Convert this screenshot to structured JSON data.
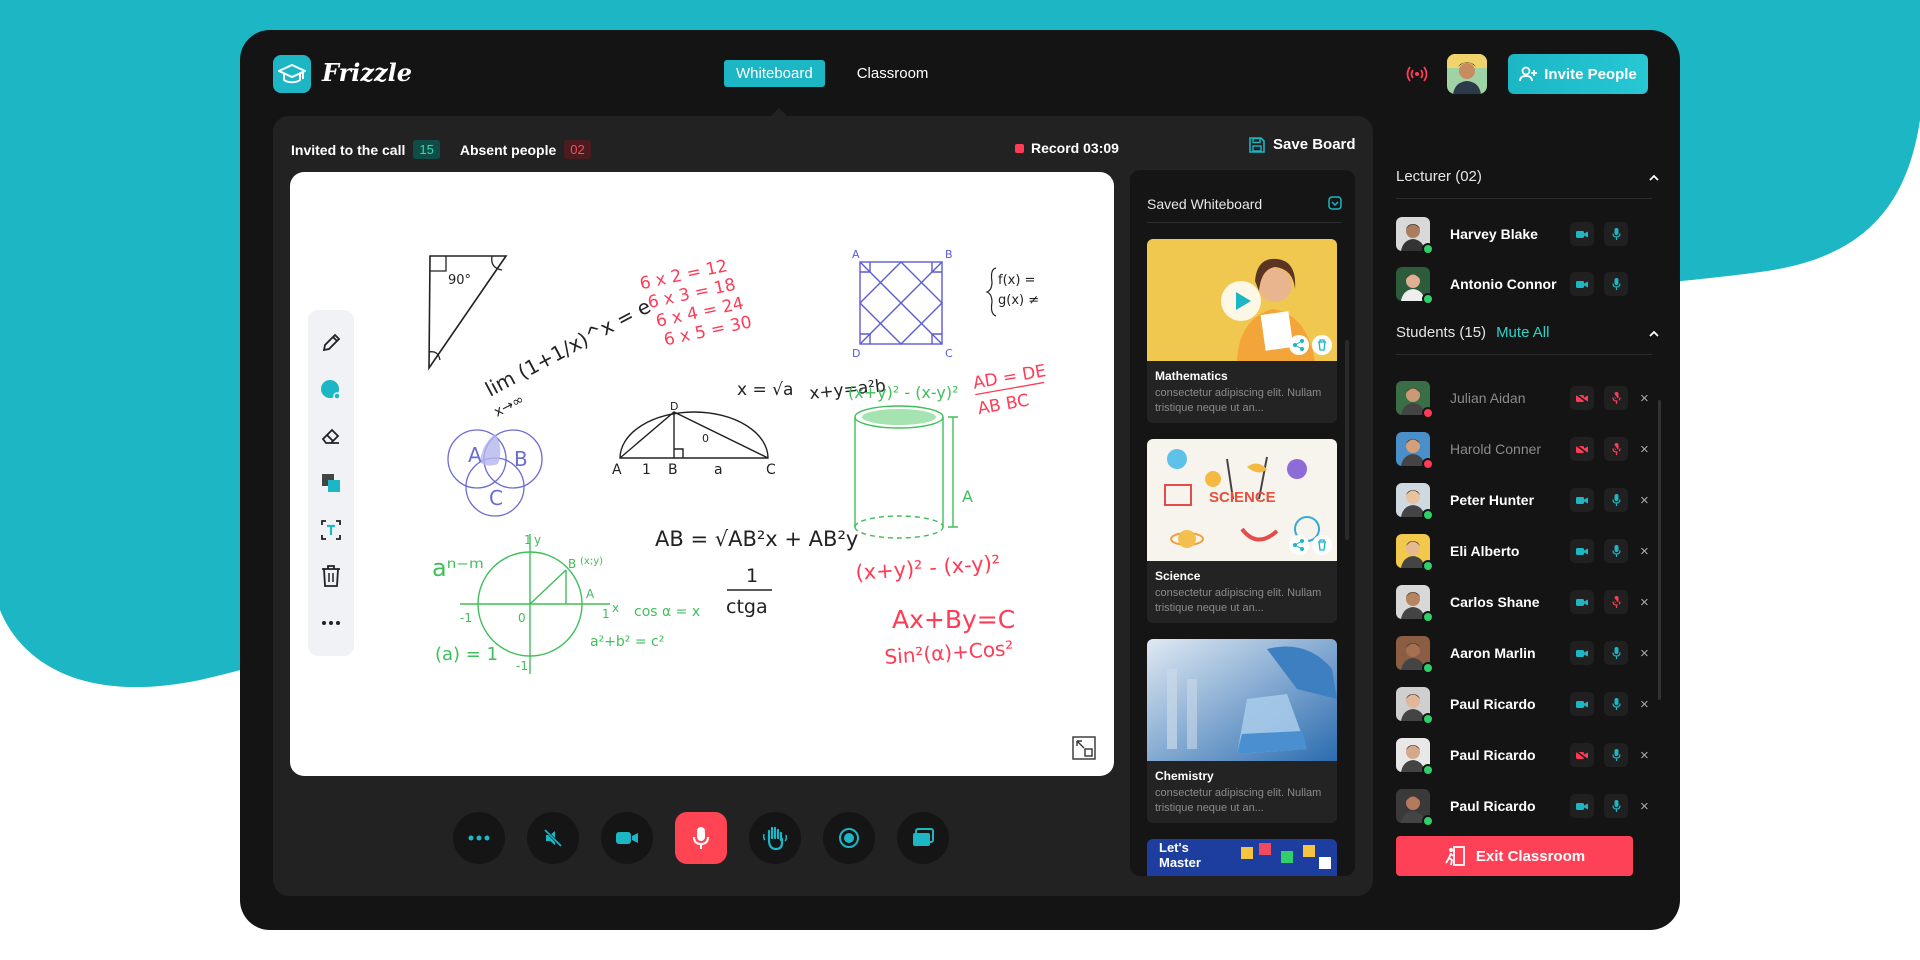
{
  "app": {
    "brand": "Frizzle"
  },
  "tabs": [
    {
      "label": "Whiteboard",
      "active": true
    },
    {
      "label": "Classroom",
      "active": false
    }
  ],
  "header": {
    "invite_label": "Invite People"
  },
  "call": {
    "invited_label": "Invited to the call",
    "invited_count": "15",
    "absent_label": "Absent people",
    "absent_count": "02",
    "record_label": "Record 03:09",
    "save_label": "Save Board"
  },
  "whiteboard": {
    "tools": [
      "pencil-icon",
      "color-picker-icon",
      "eraser-icon",
      "layers-icon",
      "text-tool-icon",
      "trash-icon",
      "more-icon"
    ],
    "handwriting": {
      "angle": "90°",
      "limit": "lim (1+1/x)^x = e",
      "limit_sub": "x→∞",
      "table": [
        "6 x 2 = 12",
        "6 x 3 = 18",
        "6 x 4 = 24",
        "6 x 5 = 30"
      ],
      "func1": "f(x) =",
      "func2": "g(x) ≠",
      "sqrt": "x = √a",
      "xya": "x+y=a²b",
      "ratio_top": "AD = DE",
      "ratio_bot": "AB   BC",
      "venn": [
        "A",
        "B",
        "C"
      ],
      "tri_labels": [
        "A",
        "1",
        "B",
        "a",
        "C",
        "D",
        "0"
      ],
      "cyl_eq": "(x+y)² - (x-y)²",
      "cyl_a": "A",
      "ab_eq": "AB = √AB²x + AB²y",
      "frac_num": "1",
      "frac_den": "ctga",
      "apow": "aⁿ⁻ᵐ",
      "a0": "(a) = 1",
      "circle_labels": [
        "1",
        "y",
        "B",
        "(x;y)",
        "A",
        "1",
        "x",
        "-1",
        "0",
        "-1"
      ],
      "cos": "cos α = x",
      "a2b2": "a²+b² = c²",
      "sq_eq": "(x+y)² - (x-y)²",
      "abc": "Ax+By=C",
      "sin": "Sin²(α)+Cos²"
    }
  },
  "controls": [
    "more-icon",
    "mute-speaker-icon",
    "camera-icon",
    "microphone-icon",
    "raise-hand-icon",
    "record-icon",
    "share-screen-icon"
  ],
  "saved": {
    "title": "Saved Whiteboard",
    "cards": [
      {
        "title": "Mathematics",
        "desc": "consectetur adipiscing elit. Nullam tristique neque ut an..."
      },
      {
        "title": "Science",
        "desc": "consectetur adipiscing elit. Nullam tristique neque ut an...",
        "thumb_text": "SCIENCE"
      },
      {
        "title": "Chemistry",
        "desc": "consectetur adipiscing elit. Nullam tristique neque ut an..."
      },
      {
        "title": "",
        "thumb_text": "Let's Master"
      }
    ]
  },
  "lecturers": {
    "title": "Lecturer (02)",
    "people": [
      {
        "name": "Harvey Blake",
        "status": "online"
      },
      {
        "name": "Antonio Connor",
        "status": "online"
      }
    ]
  },
  "students": {
    "title": "Students (15)",
    "mute_all": "Mute All",
    "people": [
      {
        "name": "Julian Aidan",
        "status": "offline"
      },
      {
        "name": "Harold Conner",
        "status": "offline"
      },
      {
        "name": "Peter Hunter",
        "status": "online"
      },
      {
        "name": "Eli Alberto",
        "status": "online"
      },
      {
        "name": "Carlos Shane",
        "status": "online"
      },
      {
        "name": "Aaron Marlin",
        "status": "online"
      },
      {
        "name": "Paul Ricardo",
        "status": "online"
      },
      {
        "name": "Paul Ricardo",
        "status": "online"
      },
      {
        "name": "Paul Ricardo",
        "status": "online"
      }
    ],
    "close_symbol": "×"
  },
  "exit_label": "Exit Classroom",
  "colors": {
    "accent": "#1cb6c4",
    "danger": "#ff4157",
    "online": "#2fd06a",
    "app_bg": "#141414"
  }
}
